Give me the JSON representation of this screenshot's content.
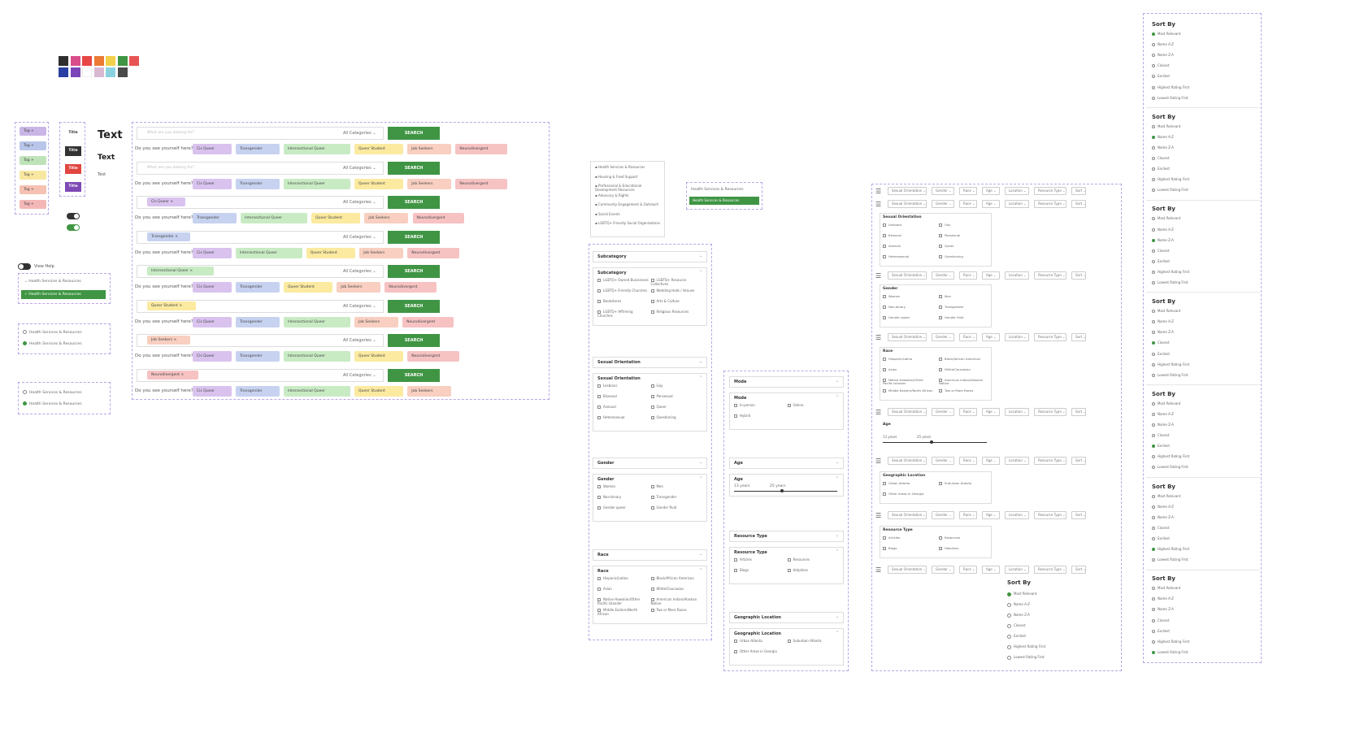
{
  "swatches_row1": [
    "#2f2f2f",
    "#d94e8a",
    "#e84545",
    "#ec7a35",
    "#f2d04a",
    "#3f9543",
    "#e85454"
  ],
  "swatches_row2": [
    "#2a3fa3",
    "#7b45b8",
    "#ffffff",
    "#d9b8d2",
    "#8ad2e0",
    "#4a4a4a"
  ],
  "tags_list": [
    {
      "label": "Tag +",
      "color": "#c9b6e6"
    },
    {
      "label": "Tag +",
      "color": "#b9c6ea"
    },
    {
      "label": "Tag +",
      "color": "#bfe3b9"
    },
    {
      "label": "Tag +",
      "color": "#f8e7a0"
    },
    {
      "label": "Tag +",
      "color": "#f6c1b2"
    },
    {
      "label": "Tag +",
      "color": "#f4b7b7"
    }
  ],
  "titles": {
    "title_label": "Title",
    "title_dark": "Title",
    "title_red": "Title",
    "title_purple": "Title"
  },
  "typography": {
    "h1": "Text",
    "h2": "Text",
    "small": "Text"
  },
  "view_help": "View Help",
  "health_dropdown": {
    "collapsed": "Health Services & Resources",
    "selected": "Health Services & Resources"
  },
  "radio_demo_1": [
    "Health Services & Resources",
    "Health Services & Resources"
  ],
  "radio_demo_2": [
    "Health Services & Resources",
    "Health Services & Resources"
  ],
  "search": {
    "placeholder": "What are you looking for?",
    "all_categories": "All Categories",
    "button": "SEARCH",
    "question": "Do you see yourself here?"
  },
  "search_rows": [
    {
      "query": "",
      "tags": [
        [
          "Cis Queer",
          "#d9c3ee"
        ],
        [
          "Transgender",
          "#c7d2f0"
        ],
        [
          "Intersectional Queer",
          "#c8ebc4"
        ],
        [
          "Queer Student",
          "#fbeaa0"
        ],
        [
          "Job Seekers",
          "#f8cfc0"
        ],
        [
          "Neurodivergent",
          "#f6c2c2"
        ]
      ]
    },
    {
      "query": "",
      "tags": [
        [
          "Cis Queer",
          "#d9c3ee"
        ],
        [
          "Transgender",
          "#c7d2f0"
        ],
        [
          "Intersectional Queer",
          "#c8ebc4"
        ],
        [
          "Queer Student",
          "#fbeaa0"
        ],
        [
          "Job Seekers",
          "#f8cfc0"
        ],
        [
          "Neurodivergent",
          "#f6c2c2"
        ]
      ]
    },
    {
      "query": "Cis Queer",
      "qcolor": "#d9c3ee",
      "tags": [
        [
          "Transgender",
          "#c7d2f0"
        ],
        [
          "Intersectional Queer",
          "#c8ebc4"
        ],
        [
          "Queer Student",
          "#fbeaa0"
        ],
        [
          "Job Seekers",
          "#f8cfc0"
        ],
        [
          "Neurodivergent",
          "#f6c2c2"
        ]
      ]
    },
    {
      "query": "Transgender",
      "qcolor": "#c7d2f0",
      "tags": [
        [
          "Cis Queer",
          "#d9c3ee"
        ],
        [
          "Intersectional Queer",
          "#c8ebc4"
        ],
        [
          "Queer Student",
          "#fbeaa0"
        ],
        [
          "Job Seekers",
          "#f8cfc0"
        ],
        [
          "Neurodivergent",
          "#f6c2c2"
        ]
      ]
    },
    {
      "query": "Intersectional Queer",
      "qcolor": "#c8ebc4",
      "tags": [
        [
          "Cis Queer",
          "#d9c3ee"
        ],
        [
          "Transgender",
          "#c7d2f0"
        ],
        [
          "Queer Student",
          "#fbeaa0"
        ],
        [
          "Job Seekers",
          "#f8cfc0"
        ],
        [
          "Neurodivergent",
          "#f6c2c2"
        ]
      ]
    },
    {
      "query": "Queer Student",
      "qcolor": "#fbeaa0",
      "tags": [
        [
          "Cis Queer",
          "#d9c3ee"
        ],
        [
          "Transgender",
          "#c7d2f0"
        ],
        [
          "Intersectional Queer",
          "#c8ebc4"
        ],
        [
          "Job Seekers",
          "#f8cfc0"
        ],
        [
          "Neurodivergent",
          "#f6c2c2"
        ]
      ]
    },
    {
      "query": "Job Seekers",
      "qcolor": "#f8cfc0",
      "tags": [
        [
          "Cis Queer",
          "#d9c3ee"
        ],
        [
          "Transgender",
          "#c7d2f0"
        ],
        [
          "Intersectional Queer",
          "#c8ebc4"
        ],
        [
          "Queer Student",
          "#fbeaa0"
        ],
        [
          "Neurodivergent",
          "#f6c2c2"
        ]
      ]
    },
    {
      "query": "Neurodivergent",
      "qcolor": "#f6c2c2",
      "tags": [
        [
          "Cis Queer",
          "#d9c3ee"
        ],
        [
          "Transgender",
          "#c7d2f0"
        ],
        [
          "Intersectional Queer",
          "#c8ebc4"
        ],
        [
          "Queer Student",
          "#fbeaa0"
        ],
        [
          "Job Seekers",
          "#f8cfc0"
        ]
      ]
    }
  ],
  "category_menu": [
    "Health Services & Resources",
    "Housing & Food Support",
    "Professional & Educational Development Resources",
    "Advocacy & Rights",
    "Community Engagement & Outreach",
    "Social Events",
    "LGBTQ+ Friendly Social Organizations"
  ],
  "category_small_dropdown": {
    "collapsed": "Health Services & Resources",
    "selected": "Health Services & Resources"
  },
  "subcategory": {
    "title": "Subcategory",
    "options": [
      "LGBTQ+ Owned Businesses",
      "LGBTQ+ Resource Collectives",
      "LGBTQ+ Friendly Churches",
      "Wedding Halls / Venues",
      "Bookstores",
      "Arts & Culture",
      "LGBTQ+ Affirming Churches",
      "Religious Resources"
    ]
  },
  "sexual_orientation": {
    "title": "Sexual Orientation",
    "options": [
      "Lesbians",
      "Gay",
      "Bisexual",
      "Pansexual",
      "Asexual",
      "Queer",
      "Heterosexual",
      "Questioning"
    ]
  },
  "gender": {
    "title": "Gender",
    "options": [
      "Women",
      "Men",
      "Non-binary",
      "Transgender",
      "Gender queer",
      "Gender fluid"
    ]
  },
  "race": {
    "title": "Race",
    "options": [
      "Hispanic/Latino",
      "Black/African American",
      "Asian",
      "White/Caucasian",
      "Native Hawaiian/Other Pacific Islander",
      "American Indian/Alaskan Native",
      "Middle Eastern/North African",
      "Two or More Races"
    ]
  },
  "mode": {
    "title": "Mode",
    "options": [
      "In-person",
      "Online",
      "Hybrid"
    ]
  },
  "age": {
    "title": "Age",
    "min_label": "13 years",
    "max_label": "25 years",
    "slider_fraction": 0.45
  },
  "resource_type": {
    "title": "Resource Type",
    "options": [
      "Articles",
      "Resources",
      "Blogs",
      "Helplines"
    ]
  },
  "geo": {
    "title": "Geographic Location",
    "options": [
      "Urban Atlanta",
      "Suburban Atlanta",
      "Other Areas in Georgia"
    ]
  },
  "filter_bar": [
    "Sexual Orientation",
    "Gender",
    "Race",
    "Age",
    "Location",
    "Resource Type",
    "Sort"
  ],
  "sort_by": {
    "title": "Sort By",
    "options": [
      "Most Relevant",
      "Name A-Z",
      "Name Z-A",
      "Closest",
      "Earliest",
      "Highest Rating First",
      "Lowest Rating First"
    ],
    "column_selected": [
      0,
      1,
      2,
      3,
      4,
      5,
      6
    ]
  },
  "bottom_sort_selected": 0
}
